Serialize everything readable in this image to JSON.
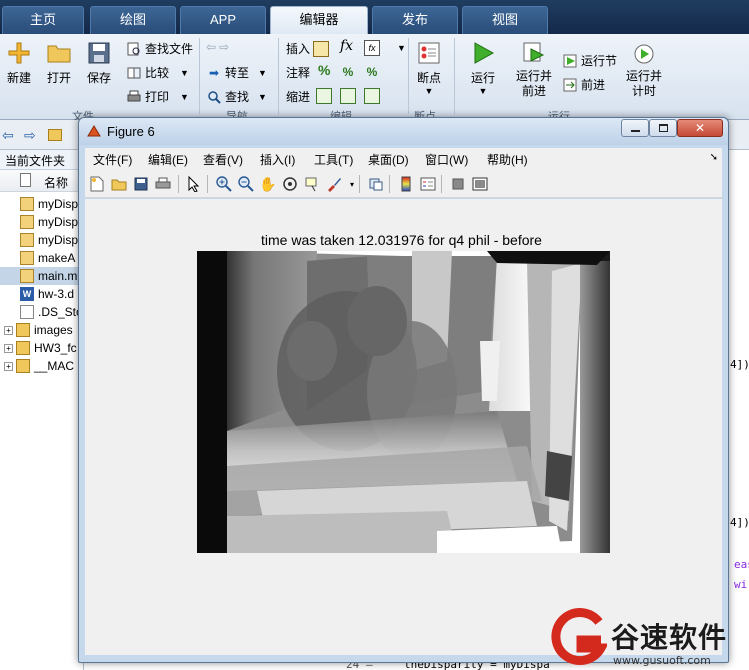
{
  "ribbon_tabs": [
    {
      "label": "主页",
      "active": false
    },
    {
      "label": "绘图",
      "active": false
    },
    {
      "label": "APP",
      "active": false
    },
    {
      "label": "编辑器",
      "active": true
    },
    {
      "label": "发布",
      "active": false
    },
    {
      "label": "视图",
      "active": false
    }
  ],
  "ribbon": {
    "new_label": "新建",
    "open_label": "打开",
    "save_label": "保存",
    "find_files_label": "查找文件",
    "compare_label": "比较",
    "print_label": "打印",
    "goto_label": "转至",
    "find_label": "查找",
    "insert_label": "插入",
    "fx_label": "fx",
    "comment_label": "注释",
    "percent_label": "%",
    "indent_label": "缩进",
    "breakpoints_label": "断点",
    "run_label": "运行",
    "run_advance_label": "运行并\n前进",
    "run_section_label": "运行节",
    "advance_label": "前进",
    "run_time_label": "运行并\n计时",
    "group_file": "文件",
    "group_nav": "导航",
    "group_edit": "编辑",
    "group_bp": "断点",
    "group_run": "运行"
  },
  "file_browser": {
    "title": "当前文件夹",
    "column_name": "名称",
    "files": [
      {
        "name": "myDisp",
        "type": "m"
      },
      {
        "name": "myDisp",
        "type": "m"
      },
      {
        "name": "myDisp",
        "type": "m"
      },
      {
        "name": "makeA",
        "type": "m"
      },
      {
        "name": "main.m",
        "type": "m",
        "selected": true
      },
      {
        "name": "hw-3.d",
        "type": "doc"
      },
      {
        "name": ".DS_Sto",
        "type": "file"
      },
      {
        "name": "images",
        "type": "folder"
      },
      {
        "name": "HW3_fc",
        "type": "folder"
      },
      {
        "name": "__MAC",
        "type": "folder"
      }
    ]
  },
  "editor": {
    "line_number": "24",
    "code_line": "theDisparity = myDispa",
    "fragment_1": "4])",
    "fragment_2": "4])",
    "fragment_3": "eas",
    "fragment_4": "wi"
  },
  "figure": {
    "window_title": "Figure 6",
    "menus": [
      "文件(F)",
      "编辑(E)",
      "查看(V)",
      "插入(I)",
      "工具(T)",
      "桌面(D)",
      "窗口(W)",
      "帮助(H)"
    ],
    "plot_title": "time was taken 12.031976 for q4 phil - before",
    "toolbar_icons": [
      "new-figure-icon",
      "open-file-icon",
      "save-icon",
      "print-icon",
      "pointer-icon",
      "zoom-in-icon",
      "zoom-out-icon",
      "pan-icon",
      "rotate-3d-icon",
      "data-cursor-icon",
      "brush-icon",
      "link-plot-icon",
      "colorbar-icon",
      "legend-icon",
      "hide-plot-tools-icon",
      "show-plot-tools-icon"
    ]
  },
  "watermark": {
    "text": "谷速软件",
    "url": "www.gusuoft.com"
  }
}
